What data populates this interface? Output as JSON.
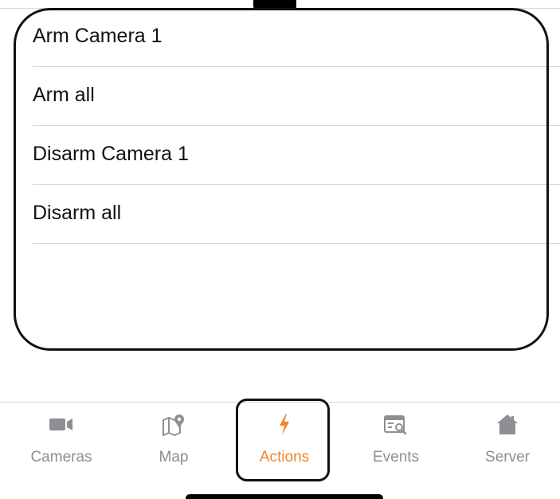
{
  "actions": {
    "items": [
      {
        "label": "Arm Camera 1"
      },
      {
        "label": "Arm all"
      },
      {
        "label": "Disarm Camera 1"
      },
      {
        "label": "Disarm all"
      }
    ]
  },
  "tabbar": {
    "tabs": [
      {
        "label": "Cameras",
        "icon": "video-camera-icon",
        "active": false
      },
      {
        "label": "Map",
        "icon": "map-pin-icon",
        "active": false
      },
      {
        "label": "Actions",
        "icon": "lightning-bolt-icon",
        "active": true
      },
      {
        "label": "Events",
        "icon": "event-search-icon",
        "active": false
      },
      {
        "label": "Server",
        "icon": "home-icon",
        "active": false
      }
    ],
    "active_color": "#f0862b",
    "inactive_color": "#8e8e93"
  }
}
